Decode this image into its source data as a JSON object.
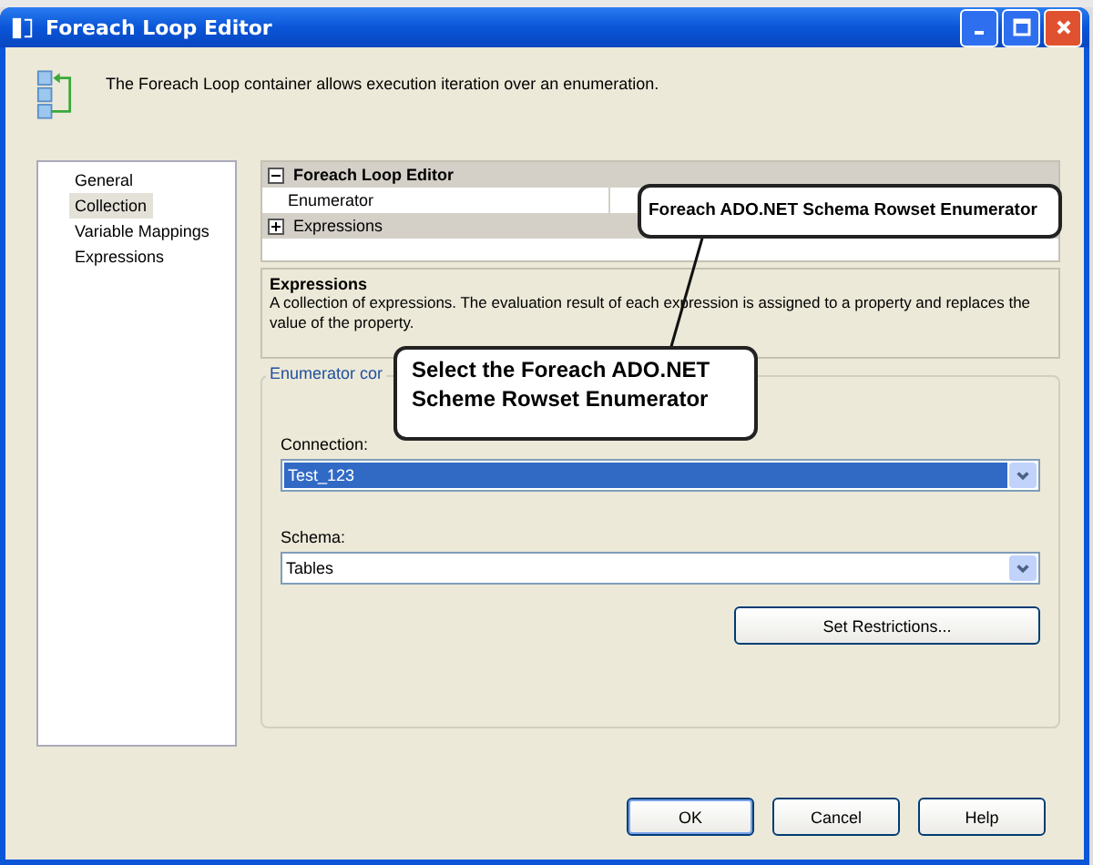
{
  "window": {
    "title": "Foreach Loop Editor"
  },
  "header": {
    "description": "The Foreach Loop container allows execution iteration over an enumeration."
  },
  "nav": [
    {
      "label": "General",
      "selected": false
    },
    {
      "label": "Collection",
      "selected": true
    },
    {
      "label": "Variable Mappings",
      "selected": false
    },
    {
      "label": "Expressions",
      "selected": false
    }
  ],
  "property_grid": [
    {
      "label": "Foreach Loop Editor",
      "expanded": true,
      "children": [
        {
          "name": "Enumerator"
        }
      ]
    },
    {
      "label": "Expressions",
      "expanded": false
    }
  ],
  "description_panel": {
    "title": "Expressions",
    "text": "A collection of expressions. The evaluation result of each expression is assigned to a property and replaces the value of the property."
  },
  "enumerator_group": {
    "legend": "Enumerator cor",
    "fields": [
      {
        "label": "Connection:",
        "value": "Test_123",
        "highlighted": true
      },
      {
        "label": "Schema:",
        "value": "Tables",
        "highlighted": false
      }
    ],
    "button": "Set Restrictions..."
  },
  "callouts": [
    {
      "text": "Foreach ADO.NET Schema Rowset Enumerator"
    },
    {
      "text": "Select the Foreach ADO.NET Scheme Rowset Enumerator"
    }
  ],
  "buttons": [
    {
      "label": "OK",
      "default": true
    },
    {
      "label": "Cancel",
      "default": false
    },
    {
      "label": "Help",
      "default": false
    }
  ]
}
